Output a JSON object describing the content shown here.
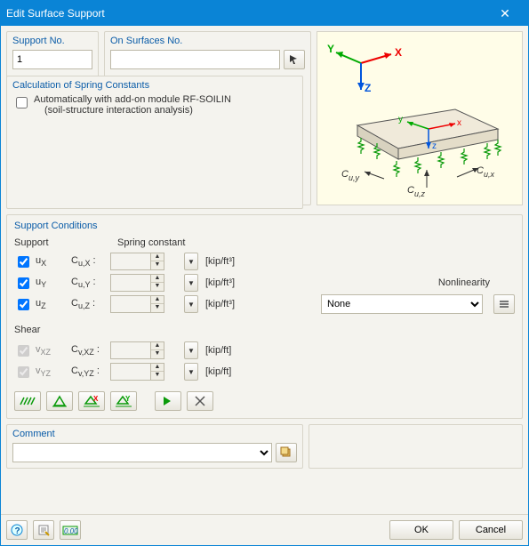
{
  "window": {
    "title": "Edit Surface Support"
  },
  "supportNo": {
    "label": "Support No.",
    "value": "1"
  },
  "onSurfaces": {
    "label": "On Surfaces No.",
    "value": ""
  },
  "calc": {
    "title": "Calculation of Spring Constants",
    "checkbox_label": "Automatically with add-on module RF-SOILIN",
    "sub_label": "(soil-structure interaction analysis)"
  },
  "supportCond": {
    "title": "Support Conditions",
    "support_head": "Support",
    "spring_head": "Spring constant",
    "shear_head": "Shear",
    "nonlin_label": "Nonlinearity",
    "nonlin_value": "None",
    "rows": {
      "ux": {
        "label": "uX",
        "const": "Cu,X :",
        "unit": "[kip/ft³]",
        "checked": true,
        "enabled": true
      },
      "uy": {
        "label": "uY",
        "const": "Cu,Y :",
        "unit": "[kip/ft³]",
        "checked": true,
        "enabled": true
      },
      "uz": {
        "label": "uZ",
        "const": "Cu,Z :",
        "unit": "[kip/ft³]",
        "checked": true,
        "enabled": true
      },
      "vxz": {
        "label": "vXZ",
        "const": "Cv,XZ :",
        "unit": "[kip/ft]",
        "checked": true,
        "enabled": false
      },
      "vyz": {
        "label": "vYZ",
        "const": "Cv,YZ :",
        "unit": "[kip/ft]",
        "checked": true,
        "enabled": false
      }
    }
  },
  "comment": {
    "title": "Comment",
    "value": ""
  },
  "buttons": {
    "ok": "OK",
    "cancel": "Cancel"
  }
}
